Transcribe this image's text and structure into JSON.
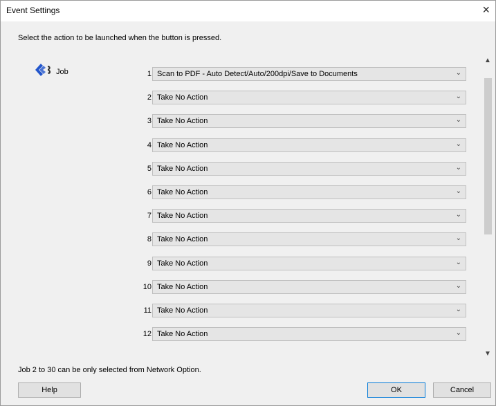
{
  "window": {
    "title": "Event Settings",
    "close_label": "×",
    "instruction": "Select the action to be launched when the button is pressed.",
    "job_label": "Job",
    "note": "Job 2 to 30 can be only selected from Network Option."
  },
  "jobs": [
    {
      "num": "1",
      "action": "Scan to PDF - Auto Detect/Auto/200dpi/Save to Documents"
    },
    {
      "num": "2",
      "action": "Take No Action"
    },
    {
      "num": "3",
      "action": "Take No Action"
    },
    {
      "num": "4",
      "action": "Take No Action"
    },
    {
      "num": "5",
      "action": "Take No Action"
    },
    {
      "num": "6",
      "action": "Take No Action"
    },
    {
      "num": "7",
      "action": "Take No Action"
    },
    {
      "num": "8",
      "action": "Take No Action"
    },
    {
      "num": "9",
      "action": "Take No Action"
    },
    {
      "num": "10",
      "action": "Take No Action"
    },
    {
      "num": "11",
      "action": "Take No Action"
    },
    {
      "num": "12",
      "action": "Take No Action"
    }
  ],
  "buttons": {
    "help": "Help",
    "ok": "OK",
    "cancel": "Cancel"
  },
  "icons": {
    "job_icon": "scanner-job-icon",
    "dropdown": "chevron-down-icon",
    "scroll_up": "scroll-up-arrow-icon",
    "scroll_down": "scroll-down-arrow-icon"
  },
  "colors": {
    "accent": "#0078d7",
    "job_icon_blue": "#2255cc"
  }
}
